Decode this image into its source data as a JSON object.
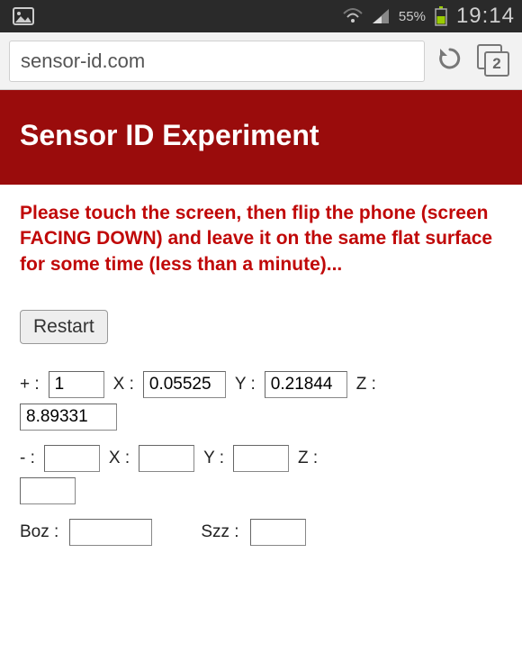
{
  "statusbar": {
    "battery_percent": "55%",
    "clock": "19:14"
  },
  "browser": {
    "url": "sensor-id.com",
    "tab_count": "2"
  },
  "page": {
    "title": "Sensor ID Experiment",
    "instructions": "Please touch the screen, then flip the phone (screen FACING DOWN) and leave it on the same flat surface for some time (less than a minute)...",
    "restart_label": "Restart"
  },
  "sensor": {
    "plus": {
      "label": "+ :",
      "n": "1",
      "xlabel": "X :",
      "x": "0.05525",
      "ylabel": "Y :",
      "y": "0.21844",
      "zlabel": "Z :",
      "z": "8.89331"
    },
    "minus": {
      "label": "- :",
      "n": "",
      "xlabel": "X :",
      "x": "",
      "ylabel": "Y :",
      "y": "",
      "zlabel": "Z :",
      "z": ""
    },
    "boz": {
      "label": "Boz :",
      "value": "",
      "szz_label": "Szz :",
      "szz": ""
    }
  },
  "icons": {
    "gallery": "gallery-icon",
    "wifi": "wifi-icon",
    "signal": "signal-icon",
    "battery": "battery-icon",
    "reload": "reload-icon",
    "tabs": "tabs-icon"
  }
}
